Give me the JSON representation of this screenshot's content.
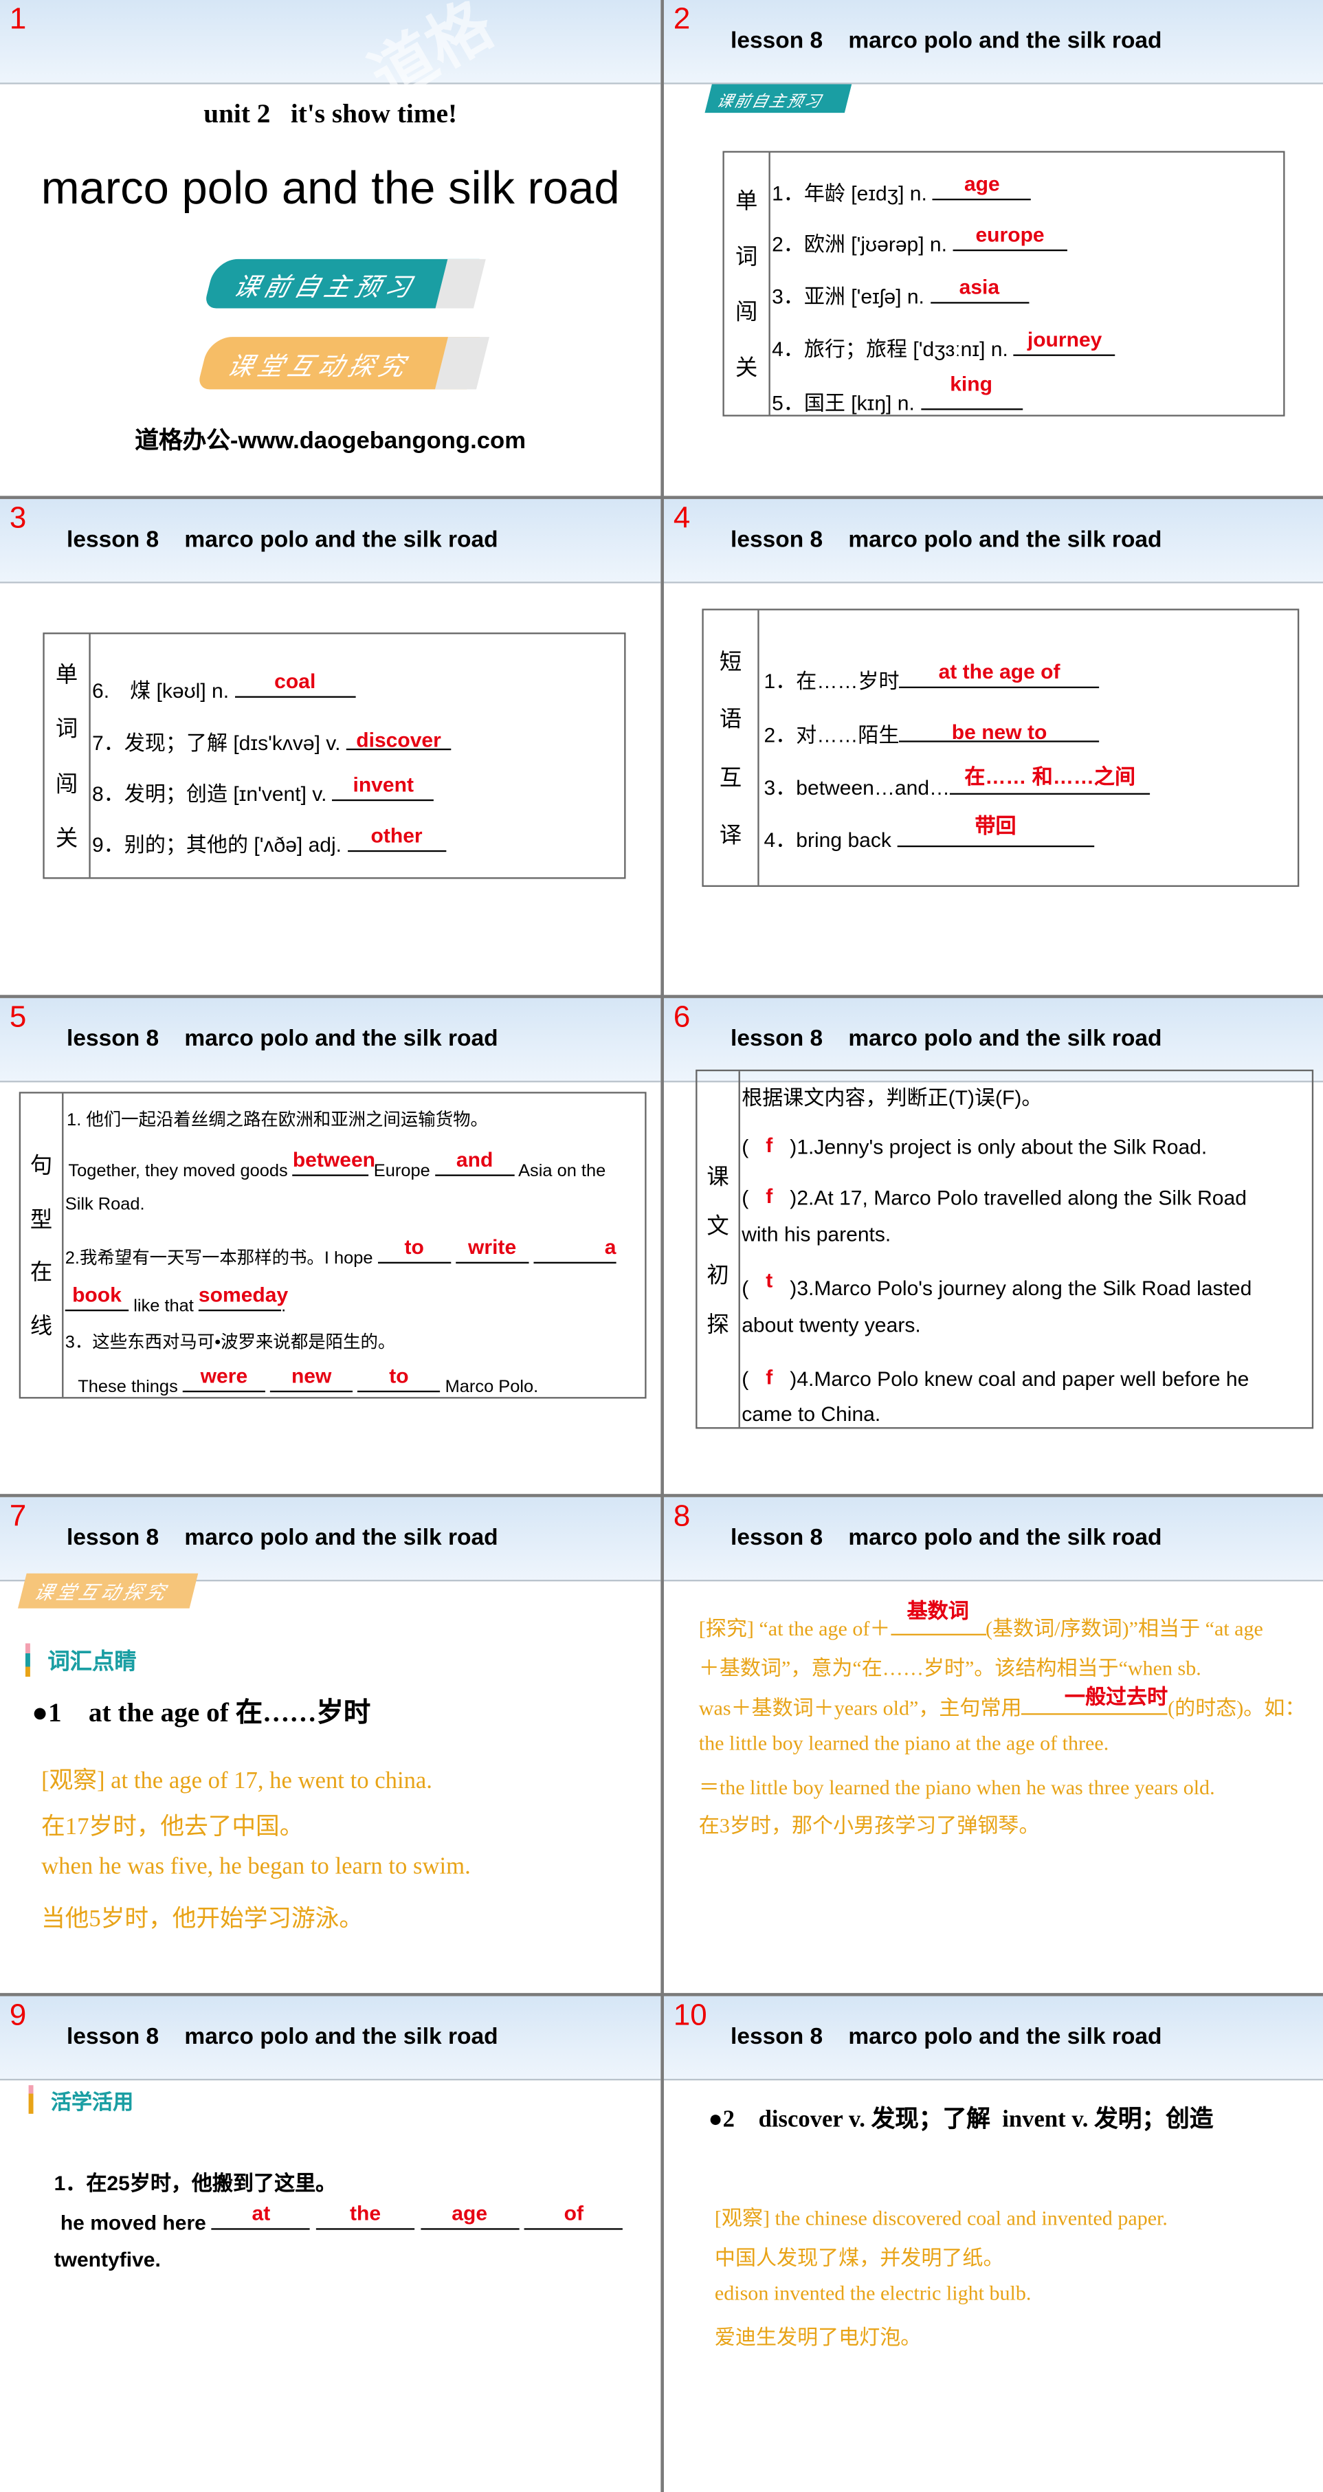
{
  "header_title": "lesson 8    marco polo and the silk road",
  "colors": {
    "answer": "#e60012",
    "teal": "#1a9ea3",
    "orange": "#f4b45c",
    "yellow_text": "#e8a317"
  },
  "slides": [
    {
      "num": "1",
      "subtitle": "unit 2   it's show time!",
      "title": "marco polo and the silk road",
      "btn1": "课前自主预习",
      "btn2": "课堂互动探究",
      "footer": "道格办公-www.daogebangong.com"
    },
    {
      "num": "2",
      "badge": "课前自主预习",
      "side": [
        "单",
        "词",
        "闯",
        "关"
      ],
      "rows": [
        {
          "q": "1．年龄 [eɪdʒ] n. ",
          "a": "age"
        },
        {
          "q": "2．欧洲 ['jʊərəp] n. ",
          "a": "europe"
        },
        {
          "q": "3．亚洲 ['eɪʃə] n. ",
          "a": "asia"
        },
        {
          "q": "4．旅行；旅程 ['dʒɜːnɪ] n. ",
          "a": "journey"
        },
        {
          "q": "5．国王 [kɪŋ] n. ",
          "a": "king"
        }
      ]
    },
    {
      "num": "3",
      "side": [
        "单",
        "词",
        "闯",
        "关"
      ],
      "rows": [
        {
          "q": "6.　煤 [kəʊl] n. ",
          "a": "coal"
        },
        {
          "q": "7．发现；了解 [dɪs'kʌvə] v. ",
          "a": "discover"
        },
        {
          "q": "8．发明；创造 [ɪn'vent] v. ",
          "a": "invent"
        },
        {
          "q": "9．别的；其他的 ['ʌðə] adj. ",
          "a": "other"
        }
      ]
    },
    {
      "num": "4",
      "side": [
        "短",
        "语",
        "互",
        "译"
      ],
      "rows": [
        {
          "q": "1．在……岁时",
          "a": "at the age of"
        },
        {
          "q": "2．对……陌生",
          "a": "be new to"
        },
        {
          "q": "3．between…and…",
          "a": "在…… 和……之间"
        },
        {
          "q": "4．bring back ",
          "a": "带回"
        }
      ]
    },
    {
      "num": "5",
      "side": [
        "句",
        "型",
        "在",
        "线"
      ],
      "l1": "1. 他们一起沿着丝绸之路在欧洲和亚洲之间运输货物。",
      "l2a": "Together, they moved goods ",
      "a1": "between",
      "l2b": " Europe ",
      "a2": "and",
      "l2c": " Asia on the",
      "l3": "Silk Road.",
      "l4": "2.我希望有一天写一本那样的书。I hope ",
      "a3": "to",
      "a4": "write",
      "a5": "a",
      "a6": "book",
      "l5b": " like that ",
      "a7": "someday",
      "l5c": ".",
      "l6": "3．这些东西对马可•波罗来说都是陌生的。",
      "l7a": "These things ",
      "a8": "were",
      "a9": "new",
      "a10": "to",
      "l7b": " Marco Polo."
    },
    {
      "num": "6",
      "side": [
        "课",
        "文",
        "初",
        "探"
      ],
      "intro": "根据课文内容，判断正(T)误(F)。",
      "items": [
        {
          "a": "f",
          "t1": ")1.Jenny's project is only about the Silk Road.",
          "t2": ""
        },
        {
          "a": "f",
          "t1": ")2.At 17, Marco Polo travelled along the Silk Road",
          "t2": "with his parents."
        },
        {
          "a": "t",
          "t1": ")3.Marco Polo's journey along the Silk Road lasted",
          "t2": "about twenty years."
        },
        {
          "a": "f",
          "t1": ")4.Marco Polo knew coal and paper well before he",
          "t2": "came to China."
        }
      ]
    },
    {
      "num": "7",
      "badge": "课堂互动探究",
      "section": "词汇点睛",
      "point": "●1　at the age of 在……岁时",
      "lines": [
        "[观察] at the age of 17, he went to china.",
        "在17岁时，他去了中国。",
        "when he was five, he began to learn to swim.",
        "当他5岁时，他开始学习游泳。"
      ]
    },
    {
      "num": "8",
      "p1a": "[探究] “at the age of＋",
      "a1": "基数词",
      "p1b": "(基数词/序数词)”相当于 “at age",
      "p2": "＋基数词”，意为“在……岁时”。该结构相当于“when sb.",
      "p3a": "was＋基数词＋years old”，主句常用",
      "a2": "一般过去时",
      "p3b": "(的时态)。如：",
      "p4": "the little boy learned the piano at the age of three.",
      "p5": "＝the little boy learned the piano when he was three years old.",
      "p6": "在3岁时，那个小男孩学习了弹钢琴。"
    },
    {
      "num": "9",
      "section": "活学活用",
      "q": "1．在25岁时，他搬到了这里。",
      "l2": "he moved here ",
      "answers": [
        "at",
        "the",
        "age",
        "of"
      ],
      "l3": "twentyfive."
    },
    {
      "num": "10",
      "point": "●2　discover v. 发现；了解  invent v. 发明；创造",
      "lines": [
        "[观察] the chinese discovered coal and invented paper.",
        "中国人发现了煤，并发明了纸。",
        "edison invented the electric light bulb.",
        "爱迪生发明了电灯泡。"
      ]
    }
  ]
}
